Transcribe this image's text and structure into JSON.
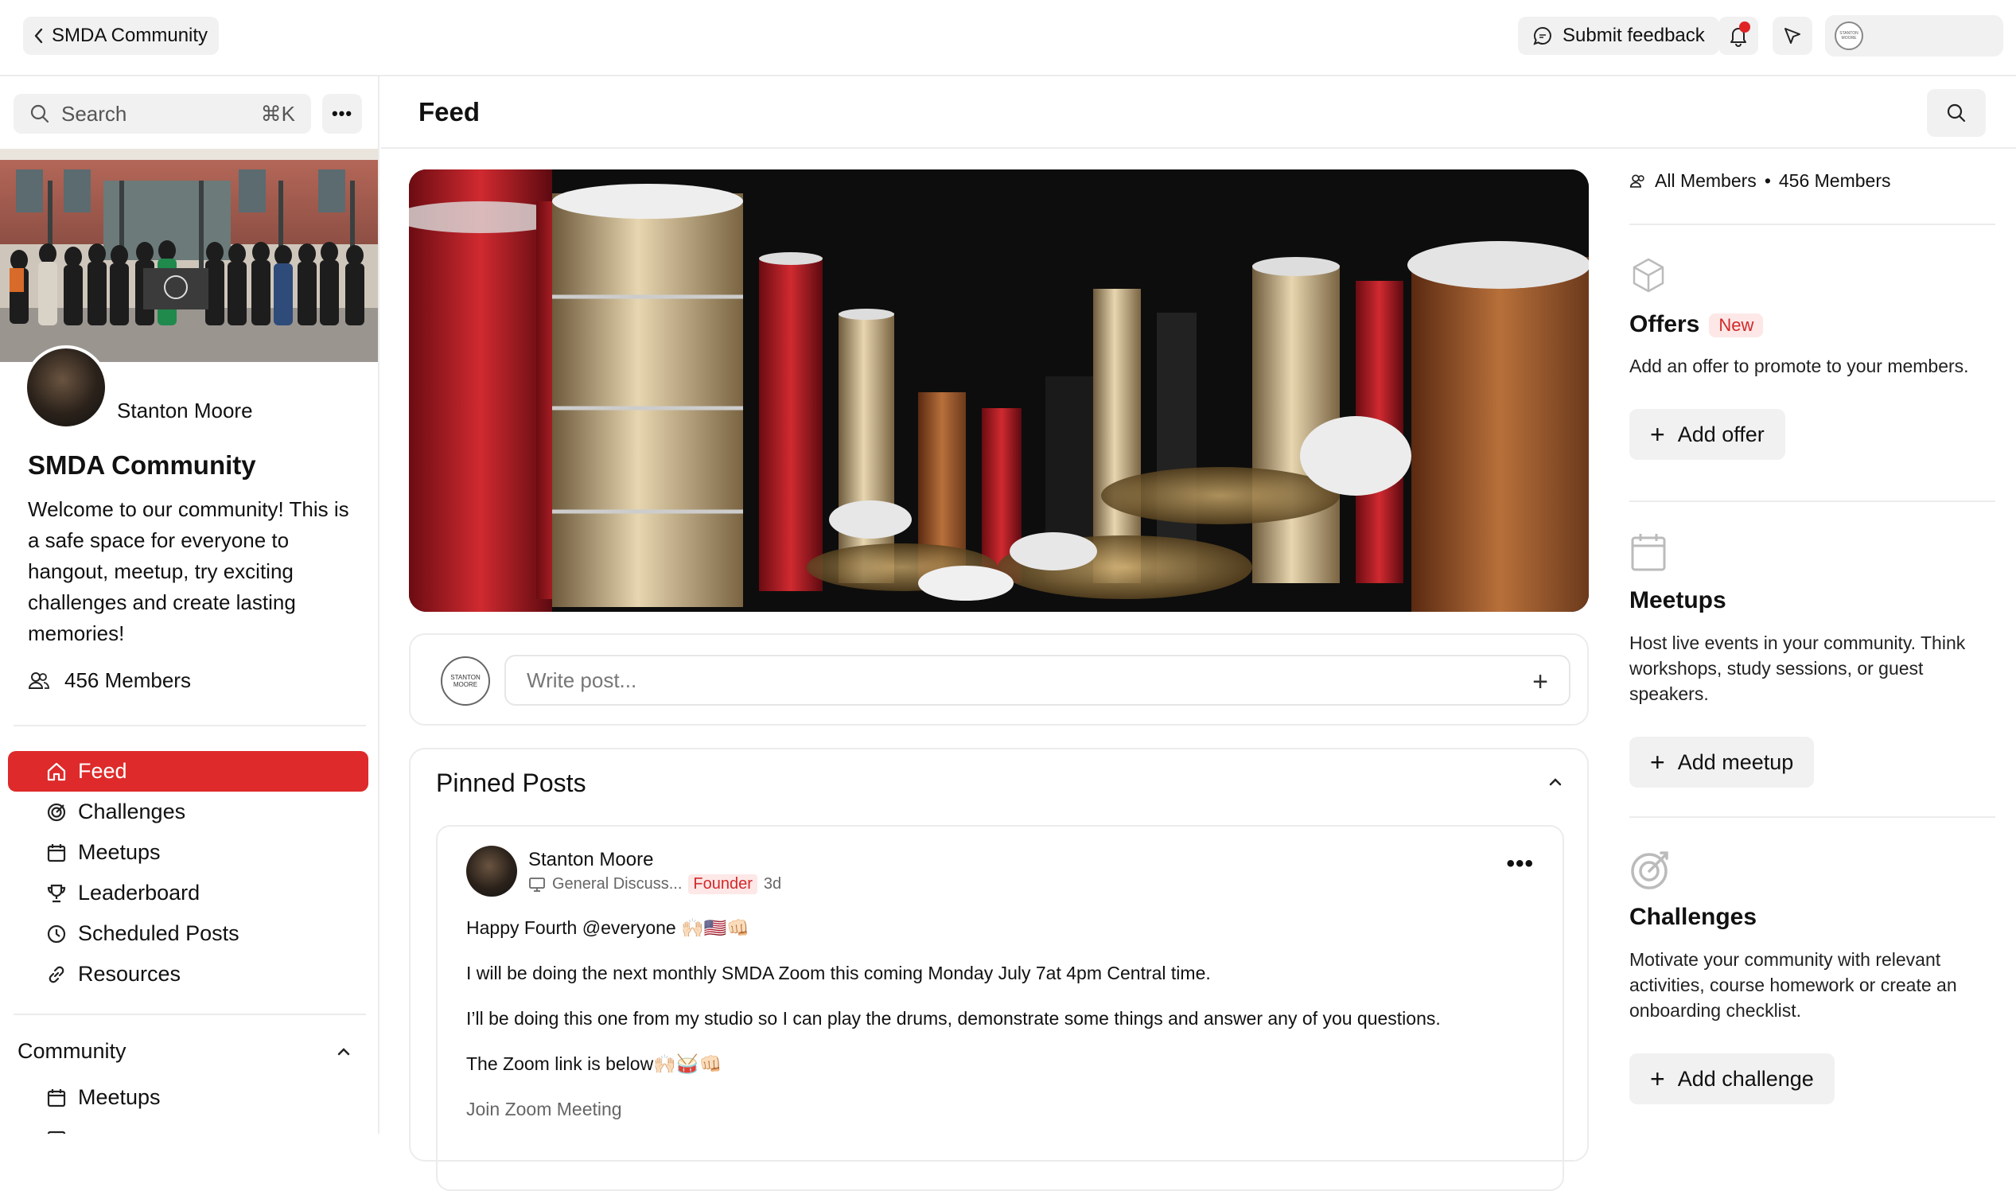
{
  "topbar": {
    "back_label": "SMDA Community",
    "feedback_label": "Submit feedback",
    "avatar_text": "STANTON MOORE"
  },
  "sidebar": {
    "search_placeholder": "Search",
    "search_shortcut": "⌘K",
    "owner_name": "Stanton Moore",
    "community_title": "SMDA Community",
    "community_description": "Welcome to our community! This is a safe space for everyone to hangout, meetup, try exciting challenges and create lasting memories!",
    "members_label": "456 Members",
    "nav": [
      {
        "label": "Feed",
        "icon": "home-icon",
        "active": true
      },
      {
        "label": "Challenges",
        "icon": "target-icon"
      },
      {
        "label": "Meetups",
        "icon": "calendar-icon"
      },
      {
        "label": "Leaderboard",
        "icon": "trophy-icon"
      },
      {
        "label": "Scheduled Posts",
        "icon": "clock-icon"
      },
      {
        "label": "Resources",
        "icon": "link-icon"
      }
    ],
    "community_section_label": "Community",
    "community_nav": [
      {
        "label": "Meetups",
        "icon": "calendar-icon"
      }
    ]
  },
  "main": {
    "title": "Feed",
    "composer_placeholder": "Write post...",
    "composer_avatar_text": "STANTON MOORE",
    "pinned_title": "Pinned Posts",
    "post": {
      "author": "Stanton Moore",
      "channel": "General Discuss...",
      "role_badge": "Founder",
      "time": "3d",
      "lines": [
        "Happy Fourth @everyone 🙌🏻🇺🇸👊🏻",
        "I will be doing the next monthly SMDA Zoom this coming Monday July 7at 4pm Central time.",
        "I’ll be doing this one from my studio so I can play the drums, demonstrate some things and answer any of you questions.",
        "The Zoom link is below🙌🏻🥁👊🏻"
      ],
      "zoom_line": "Join Zoom Meeting"
    }
  },
  "right": {
    "all_members_label": "All Members",
    "members_count_label": "456 Members",
    "offers": {
      "title": "Offers",
      "badge": "New",
      "desc": "Add an offer to promote to your members.",
      "button": "Add offer"
    },
    "meetups": {
      "title": "Meetups",
      "desc": "Host live events in your community. Think workshops, study sessions, or guest speakers.",
      "button": "Add meetup"
    },
    "challenges": {
      "title": "Challenges",
      "desc": "Motivate your community with relevant activities, course homework or create an onboarding checklist.",
      "button": "Add challenge"
    }
  },
  "colors": {
    "accent": "#de2a2a",
    "badge_bg": "#fde7e7",
    "badge_text": "#d12a2a",
    "chip_bg": "#f1f1f1"
  }
}
